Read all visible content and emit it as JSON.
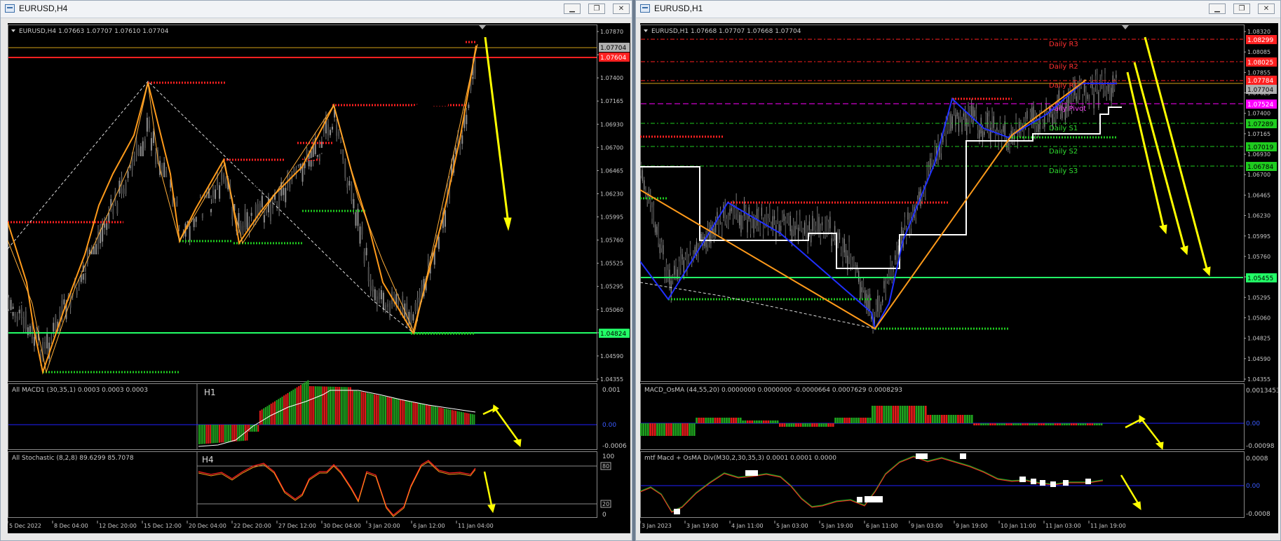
{
  "windows": {
    "left": {
      "title": "EURUSD,H4"
    },
    "right": {
      "title": "EURUSD,H1"
    }
  },
  "colors": {
    "bullish": "#1fa21f",
    "bearish": "#e31a1a",
    "signal_arrow": "#ffff00",
    "support": "#22ff66",
    "resistance": "#ff2020",
    "zigzag": "#ff9a1a",
    "pivot_line": "#ffffff"
  },
  "left_chart": {
    "header": "EURUSD,H4  1.07663 1.07707 1.07610 1.07704",
    "price_scale": [
      "1.07870",
      "1.07635",
      "1.07400",
      "1.07165",
      "1.06930",
      "1.06700",
      "1.06465",
      "1.06230",
      "1.05995",
      "1.05760",
      "1.05525",
      "1.05295",
      "1.05060",
      "1.04825",
      "1.04590",
      "1.04355"
    ],
    "price_tags": {
      "current": "1.07704",
      "resistance": "1.07604",
      "support": "1.04824"
    },
    "macd": {
      "header": "All MACD1 (30,35,1) 0.0003 0.0003 0.0003",
      "label": "H1",
      "scale": [
        "0.001",
        "0.00",
        "-0.0006"
      ]
    },
    "stoch": {
      "header": "All Stochastic (8,2,8) 89.6299 85.7078",
      "label": "H4",
      "scale": [
        "100",
        "80",
        "20",
        "0"
      ]
    },
    "time_axis": [
      "5 Dec 2022",
      "8 Dec 04:00",
      "12 Dec 20:00",
      "15 Dec 12:00",
      "20 Dec 04:00",
      "22 Dec 20:00",
      "27 Dec 12:00",
      "30 Dec 04:00",
      "3 Jan 20:00",
      "6 Jan 12:00",
      "11 Jan 04:00"
    ]
  },
  "right_chart": {
    "header": "EURUSD,H1  1.07668 1.07707 1.07668 1.07704",
    "price_scale": [
      "1.08320",
      "1.08085",
      "1.07855",
      "1.07625",
      "1.07400",
      "1.07165",
      "1.06930",
      "1.06700",
      "1.06465",
      "1.06230",
      "1.05995",
      "1.05760",
      "1.05525",
      "1.05295",
      "1.05060",
      "1.04825",
      "1.04590",
      "1.04355"
    ],
    "price_tags": {
      "r3": "1.08299",
      "r2": "1.08025",
      "r1": "1.07784",
      "current": "1.07704",
      "pivot": "1.07524",
      "s1": "1.07289",
      "s2": "1.07019",
      "s3": "1.06784",
      "support": "1.05455"
    },
    "pivot_labels": {
      "r3": "Daily R3",
      "r2": "Daily R2",
      "r1": "Daily R1",
      "pivot": "Daily Pivot",
      "s1": "Daily S1",
      "s2": "Daily S2",
      "s3": "Daily S3"
    },
    "macd": {
      "header": "MACD_OsMA (44,55,20) 0.0000000 0.0000000 -0.0000664 0.0007629 0.0008293",
      "scale": [
        "0.0013453",
        "0.00",
        "-0.00098"
      ]
    },
    "mtf": {
      "header": "mtf Macd + OsMA Div(M30,2,30,35,3) 0.0001 0.0001 0.0000",
      "scale": [
        "0.0008",
        "0.00",
        "-0.0008"
      ]
    },
    "time_axis": [
      "3 Jan 2023",
      "3 Jan 19:00",
      "4 Jan 11:00",
      "5 Jan 03:00",
      "5 Jan 19:00",
      "6 Jan 11:00",
      "9 Jan 03:00",
      "9 Jan 19:00",
      "10 Jan 11:00",
      "11 Jan 03:00",
      "11 Jan 19:00"
    ]
  }
}
